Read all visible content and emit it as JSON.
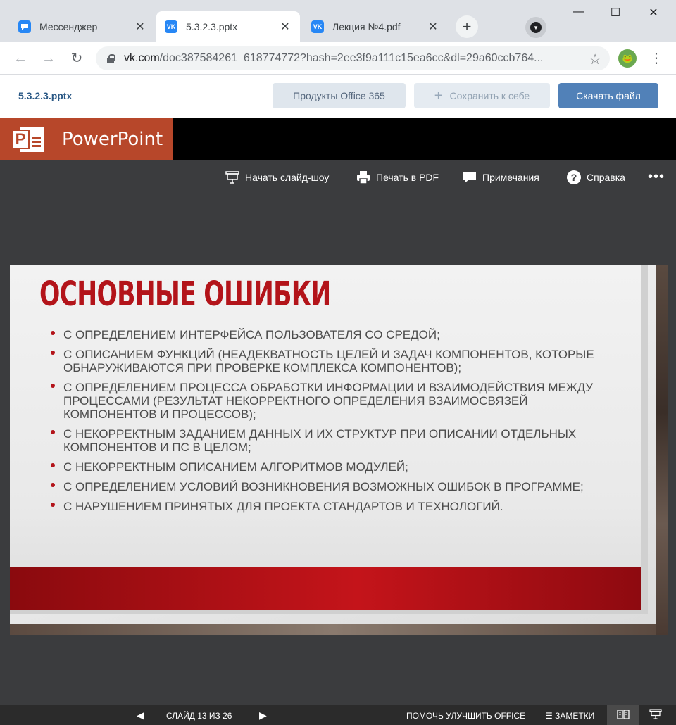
{
  "browser": {
    "tabs": [
      {
        "title": "Мессенджер",
        "icon": "chat-icon",
        "active": false
      },
      {
        "title": "5.3.2.3.pptx",
        "icon": "vk-icon",
        "active": true
      },
      {
        "title": "Лекция №4.pdf",
        "icon": "vk-icon",
        "active": false
      }
    ],
    "url_host": "vk.com",
    "url_path": "/doc387584261_618774772?hash=2ee3f9a111c15ea6cc&dl=29a60ccb764..."
  },
  "doc_header": {
    "filename": "5.3.2.3.pptx",
    "office_button": "Продукты Office 365",
    "save_button": "Сохранить к себе",
    "download_button": "Скачать файл"
  },
  "app": {
    "name": "PowerPoint",
    "brand_color": "#b7472a"
  },
  "toolbar": {
    "slideshow": "Начать слайд-шоу",
    "print": "Печать в PDF",
    "notes": "Примечания",
    "help": "Справка"
  },
  "slide": {
    "title": "ОСНОВНЫЕ ОШИБКИ",
    "bullets": [
      "С определением интерфейса пользователя со средой;",
      "С описанием функций (неадекватность целей и задач компонентов, которые обнаруживаются при проверке комплекса компонентов);",
      "С определением процесса обработки информации и взаимодействия между процессами (результат некорректного определения взаимосвязей компонентов и процессов);",
      "С некорректным заданием данных и их структур при описании отдельных компонентов и ПС в целом;",
      "С некорректным описанием алгоритмов модулей;",
      "С определением условий возникновения возможных ошибок в программе;",
      "С нарушением принятых для проекта стандартов и технологий."
    ]
  },
  "status": {
    "slide_counter": "СЛАЙД 13 ИЗ 26",
    "improve": "ПОМОЧЬ УЛУЧШИТЬ OFFICE",
    "notes": "ЗАМЕТКИ"
  }
}
